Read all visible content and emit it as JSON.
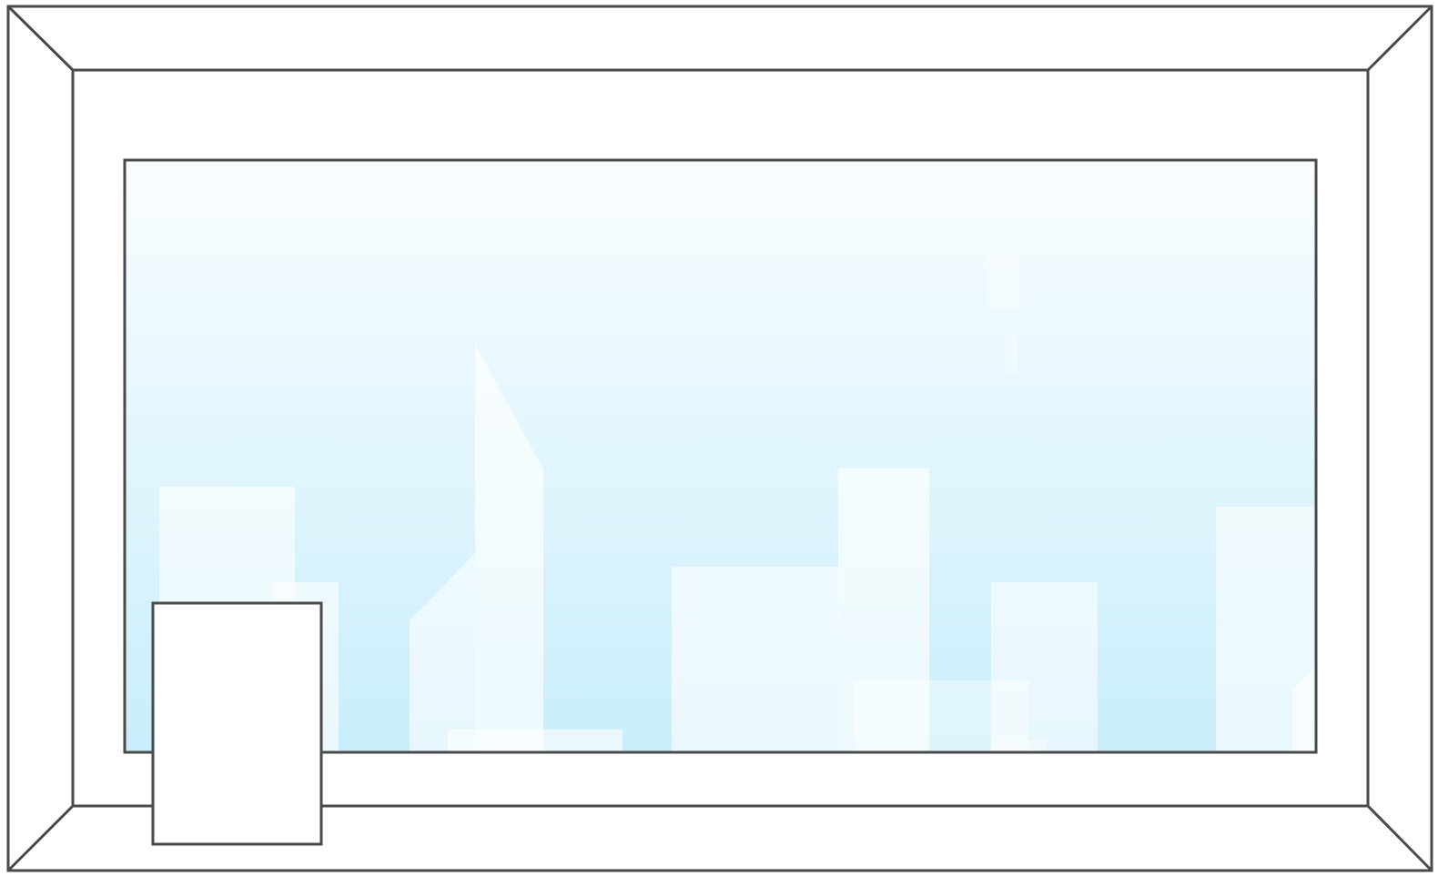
{
  "diagram": {
    "type": "window-frame-drawing",
    "colors": {
      "stroke": "#4a4a4a",
      "frame_fill": "#ffffff",
      "sky_top": "#fafdff",
      "sky_bottom": "#c9eefb",
      "building_fill": "#ffffff"
    },
    "parts": [
      "outer-frame",
      "inner-frame",
      "glass-pane",
      "city-skyline",
      "small-panel"
    ]
  }
}
